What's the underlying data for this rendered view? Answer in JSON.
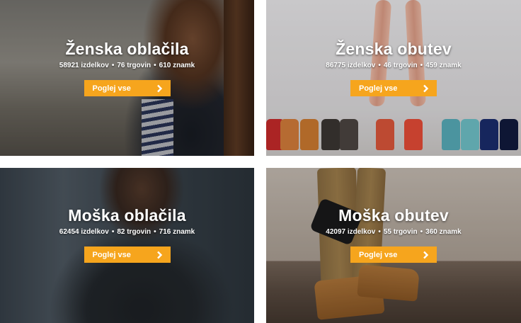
{
  "tiles": [
    {
      "title": "Ženska oblačila",
      "products": "58921 izdelkov",
      "stores": "76 trgovin",
      "brands": "610 znamk",
      "button": "Poglej vse"
    },
    {
      "title": "Ženska obutev",
      "products": "86775 izdelkov",
      "stores": "46 trgovin",
      "brands": "459 znamk",
      "button": "Poglej vse"
    },
    {
      "title": "Moška oblačila",
      "products": "62454 izdelkov",
      "stores": "82 trgovin",
      "brands": "716 znamk",
      "button": "Poglej vse"
    },
    {
      "title": "Moška obutev",
      "products": "42097 izdelkov",
      "stores": "55 trgovin",
      "brands": "360 znamk",
      "button": "Poglej vse"
    }
  ],
  "separator": "•",
  "colors": {
    "button": "#f6a51d",
    "text": "#ffffff"
  },
  "icons": {
    "button_icon": "chevron-right-icon"
  }
}
